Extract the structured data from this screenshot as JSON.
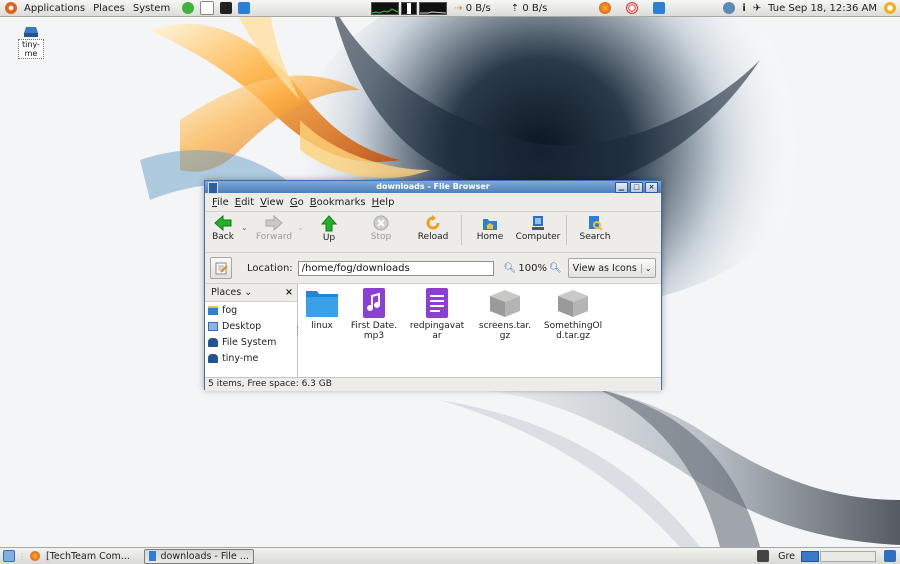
{
  "top_panel": {
    "menus": [
      "Applications",
      "Places",
      "System"
    ],
    "net_down": "0 B/s",
    "net_up": "0 B/s",
    "clock": "Tue Sep 18, 12:36 AM"
  },
  "desktop": {
    "icon_label": "tiny-me"
  },
  "window": {
    "title": "downloads - File Browser",
    "menu": [
      {
        "mnemonic": "F",
        "rest": "ile"
      },
      {
        "mnemonic": "E",
        "rest": "dit"
      },
      {
        "mnemonic": "V",
        "rest": "iew"
      },
      {
        "mnemonic": "G",
        "rest": "o"
      },
      {
        "mnemonic": "B",
        "rest": "ookmarks"
      },
      {
        "mnemonic": "H",
        "rest": "elp"
      }
    ],
    "toolbar": {
      "back": "Back",
      "forward": "Forward",
      "up": "Up",
      "stop": "Stop",
      "reload": "Reload",
      "home": "Home",
      "computer": "Computer",
      "search": "Search"
    },
    "location": {
      "label": "Location:",
      "value": "/home/fog/downloads",
      "zoom": "100%",
      "view_mode": "View as Icons"
    },
    "sidebar": {
      "title": "Places",
      "items": [
        "fog",
        "Desktop",
        "File System",
        "tiny-me"
      ]
    },
    "files": [
      {
        "line1": "linux",
        "line2": ""
      },
      {
        "line1": "First Date.",
        "line2": "mp3"
      },
      {
        "line1": "redpingavat",
        "line2": "ar"
      },
      {
        "line1": "screens.tar.",
        "line2": "gz"
      },
      {
        "line1": "SomethingOl",
        "line2": "d.tar.gz"
      }
    ],
    "status": "5 items, Free space: 6.3 GB"
  },
  "bottom_panel": {
    "tasks": [
      "[TechTeam Com...",
      "downloads - File ..."
    ],
    "keyboard_layout": "Gre"
  },
  "colors": {
    "title_blue": "#4d7fbc",
    "folder_blue": "#1e88d6",
    "media_purple": "#8b3fd6",
    "nav_green": "#22b22a",
    "reload_orange": "#f0a020"
  }
}
